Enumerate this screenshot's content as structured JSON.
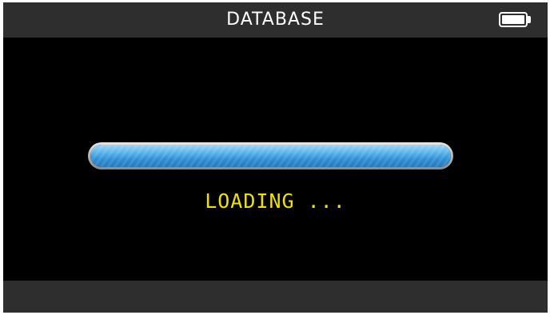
{
  "header": {
    "title": "DATABASE",
    "battery_icon": "battery-full-icon",
    "battery_level": 1.0
  },
  "main": {
    "status_text": "LOADING ...",
    "progress": 1.0
  },
  "colors": {
    "background": "#000000",
    "bar": "#2e2e2e",
    "title_text": "#ffffff",
    "status_text": "#f0e000",
    "progress_fill": "#3a9ee0"
  }
}
